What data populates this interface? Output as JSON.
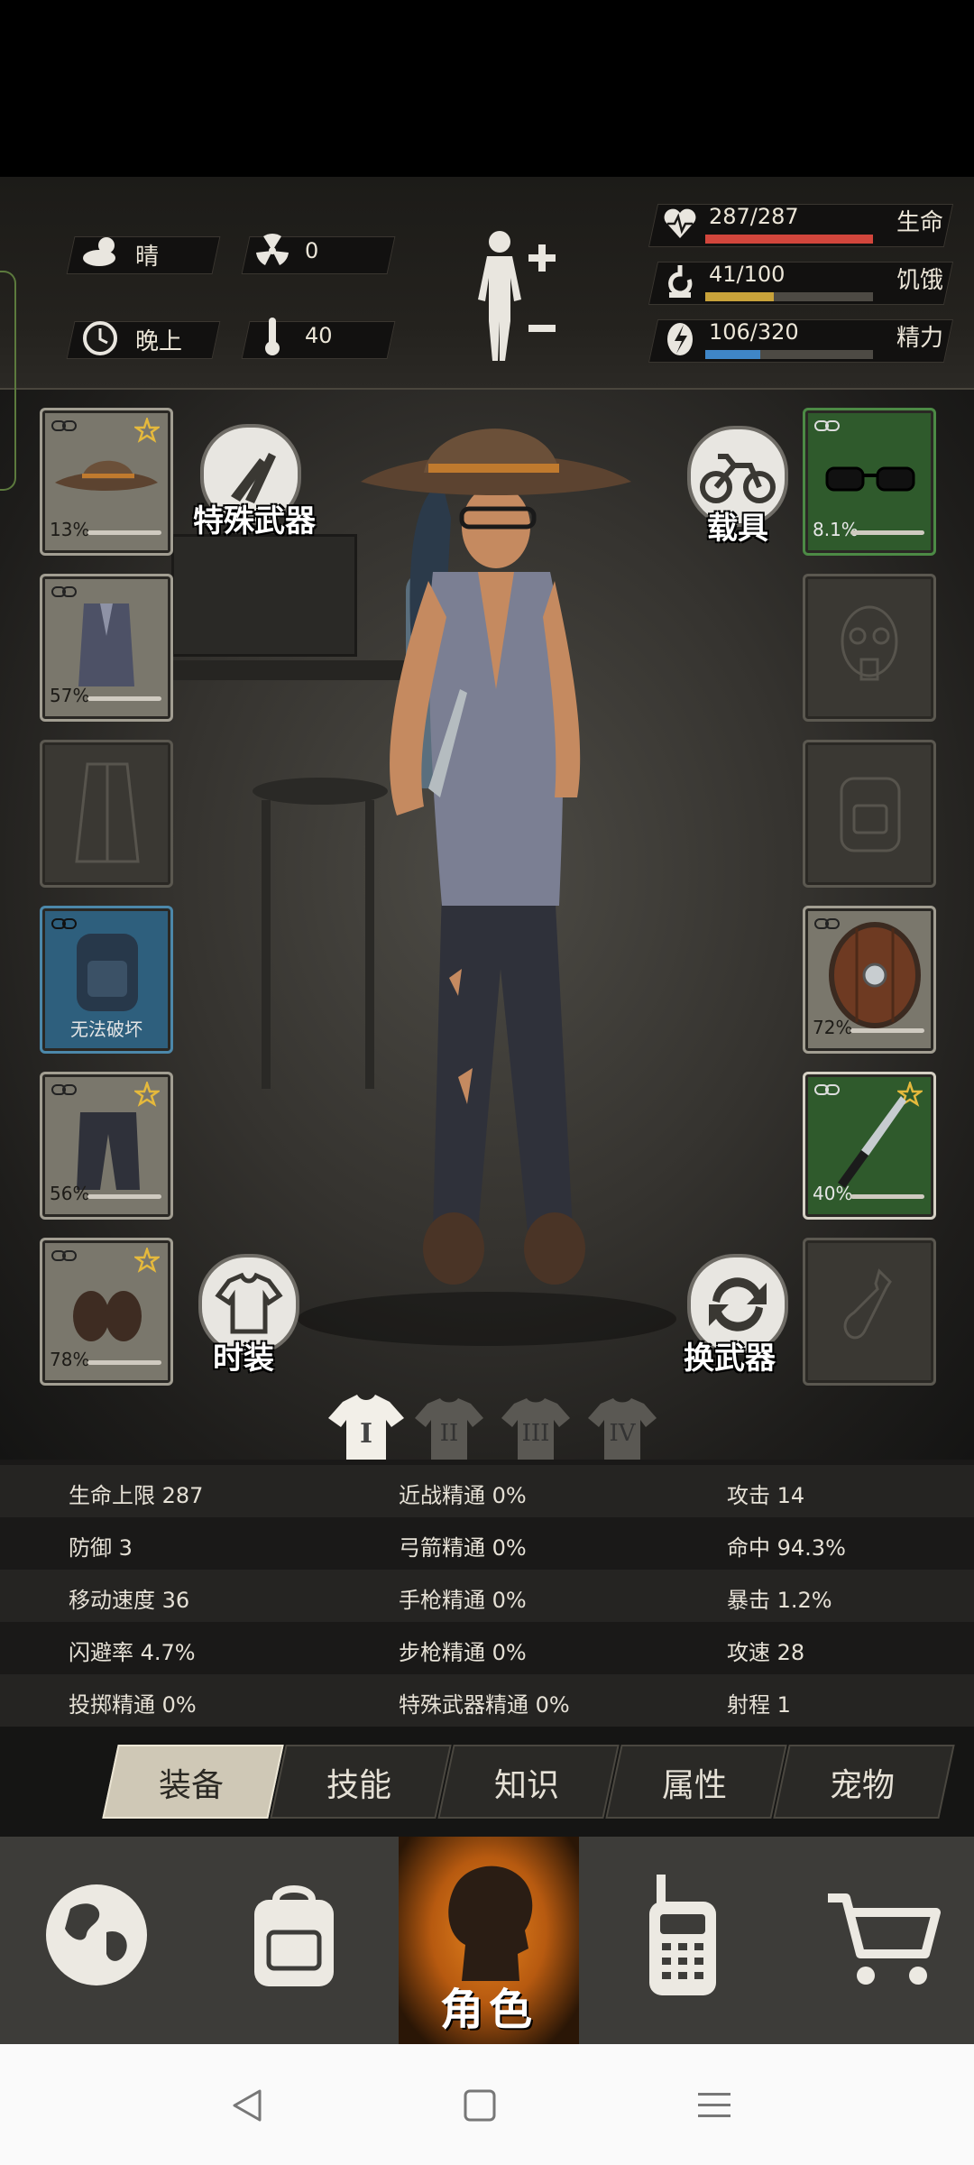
{
  "status": {
    "weather": "晴",
    "radiation": "0",
    "time_of_day": "晚上",
    "temperature": "40",
    "health": {
      "text": "287/287",
      "label": "生命",
      "fraction": 1.0,
      "color": "#d2463c"
    },
    "hunger": {
      "text": "41/100",
      "label": "饥饿",
      "fraction": 0.41,
      "color": "#c8a23a"
    },
    "energy": {
      "text": "106/320",
      "label": "精力",
      "fraction": 0.33,
      "color": "#3f86c7"
    }
  },
  "buttons": {
    "special_weapon": "特殊武器",
    "vehicle": "载具",
    "fashion": "时装",
    "switch_weapon": "换武器"
  },
  "slots": {
    "hat": "13%",
    "shirt": "57%",
    "backpack": "无法破坏",
    "pants": "56%",
    "shoes": "78%",
    "glasses": "8.1%",
    "shield": "72%",
    "knife": "40%"
  },
  "outfit_sets": [
    "I",
    "II",
    "III",
    "IV"
  ],
  "stats": [
    [
      "生命上限 287",
      "近战精通 0%",
      "攻击 14"
    ],
    [
      "防御 3",
      "弓箭精通 0%",
      "命中 94.3%"
    ],
    [
      "移动速度 36",
      "手枪精通 0%",
      "暴击 1.2%"
    ],
    [
      "闪避率 4.7%",
      "步枪精通 0%",
      "攻速 28"
    ],
    [
      "投掷精通 0%",
      "特殊武器精通 0%",
      "射程 1"
    ]
  ],
  "tabs": [
    "装备",
    "技能",
    "知识",
    "属性",
    "宠物"
  ],
  "nav": {
    "character": "角色"
  },
  "colors": {
    "accent_orange": "#e07a1c",
    "slot_green": "#2f5a2c",
    "slot_blue": "#2e5f7d"
  }
}
